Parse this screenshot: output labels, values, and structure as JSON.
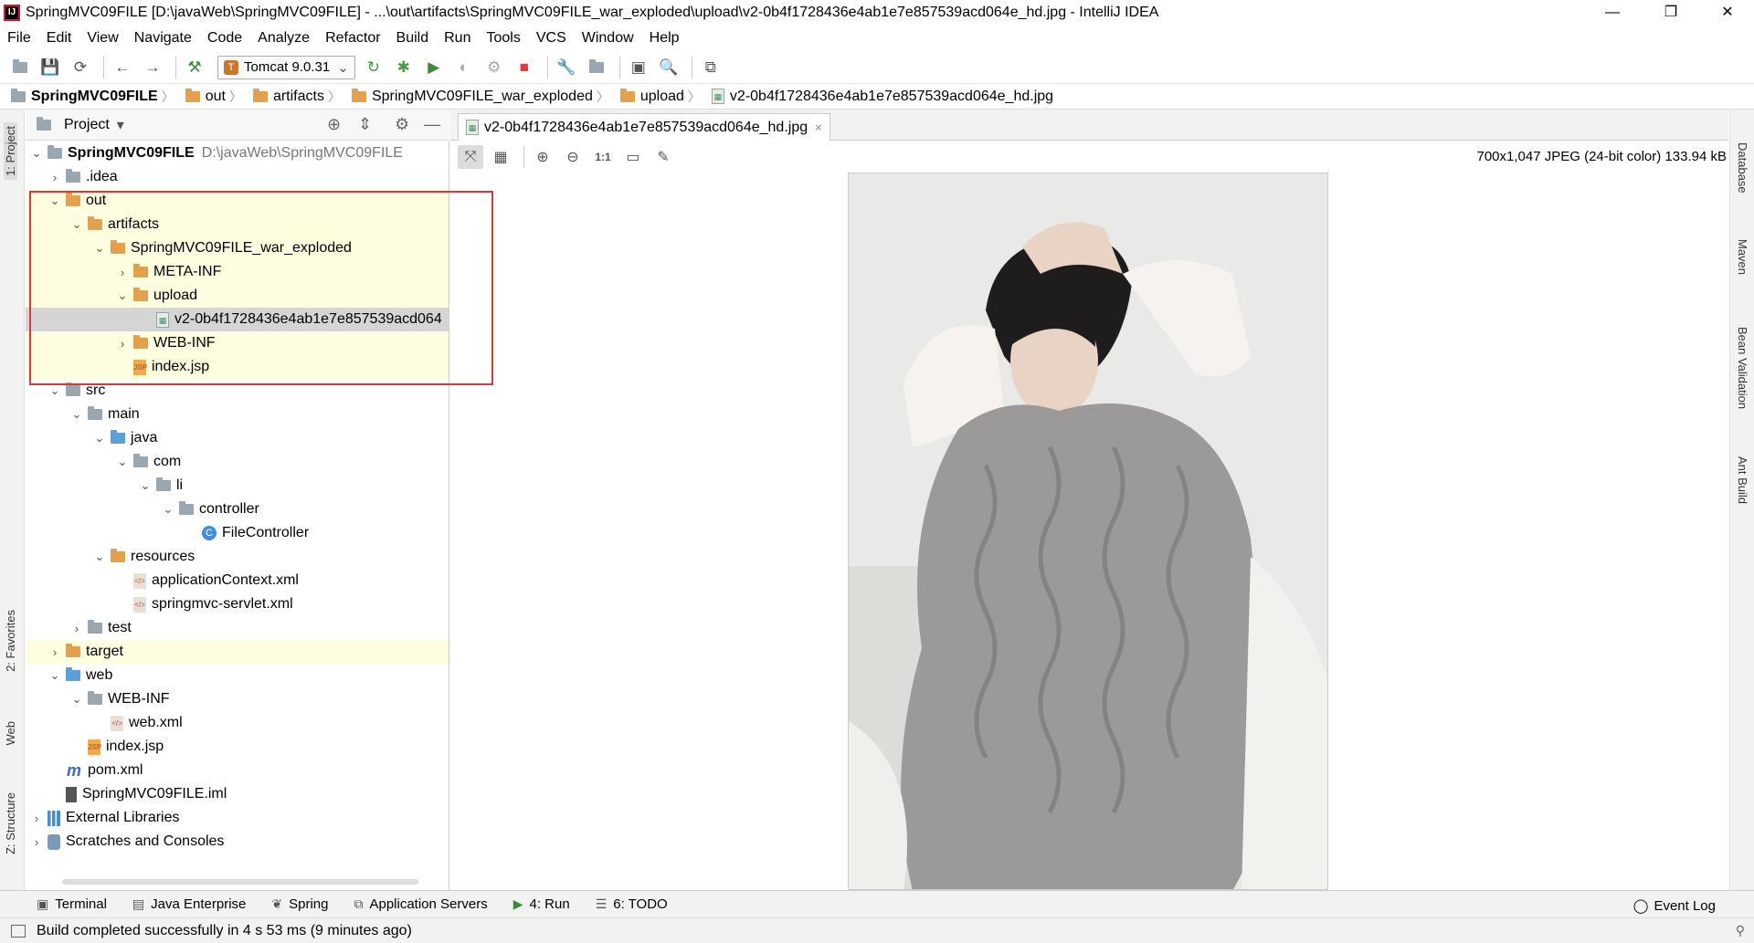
{
  "window": {
    "title": "SpringMVC09FILE [D:\\javaWeb\\SpringMVC09FILE] - ...\\out\\artifacts\\SpringMVC09FILE_war_exploded\\upload\\v2-0b4f1728436e4ab1e7e857539acd064e_hd.jpg - IntelliJ IDEA",
    "app_icon": "IJ",
    "minimize": "—",
    "restore": "❐",
    "close": "✕"
  },
  "menu": [
    "File",
    "Edit",
    "View",
    "Navigate",
    "Code",
    "Analyze",
    "Refactor",
    "Build",
    "Run",
    "Tools",
    "VCS",
    "Window",
    "Help"
  ],
  "toolbar": {
    "run_config": "Tomcat 9.0.31",
    "run_config_arrow": "⌄"
  },
  "breadcrumb": [
    "SpringMVC09FILE",
    "out",
    "artifacts",
    "SpringMVC09FILE_war_exploded",
    "upload",
    "v2-0b4f1728436e4ab1e7e857539acd064e_hd.jpg"
  ],
  "project_panel": {
    "title": "Project",
    "dropdown": "▾"
  },
  "tree": [
    {
      "label": "SpringMVC09FILE",
      "path": "D:\\javaWeb\\SpringMVC09FILE",
      "arrow": "⌄",
      "icon": "folder-gray"
    },
    {
      "label": ".idea",
      "arrow": "›",
      "icon": "folder-gray"
    },
    {
      "label": "out",
      "arrow": "⌄",
      "icon": "folder-orange"
    },
    {
      "label": "artifacts",
      "arrow": "⌄",
      "icon": "folder-orange"
    },
    {
      "label": "SpringMVC09FILE_war_exploded",
      "arrow": "⌄",
      "icon": "folder-orange"
    },
    {
      "label": "META-INF",
      "arrow": "›",
      "icon": "folder-orange"
    },
    {
      "label": "upload",
      "arrow": "⌄",
      "icon": "folder-orange"
    },
    {
      "label": "v2-0b4f1728436e4ab1e7e857539acd064",
      "arrow": "",
      "icon": "image-file"
    },
    {
      "label": "WEB-INF",
      "arrow": "›",
      "icon": "folder-orange"
    },
    {
      "label": "index.jsp",
      "arrow": "",
      "icon": "jsp-file"
    },
    {
      "label": "src",
      "arrow": "⌄",
      "icon": "folder-gray"
    },
    {
      "label": "main",
      "arrow": "⌄",
      "icon": "folder-gray"
    },
    {
      "label": "java",
      "arrow": "⌄",
      "icon": "folder-blue"
    },
    {
      "label": "com",
      "arrow": "⌄",
      "icon": "folder-gray"
    },
    {
      "label": "li",
      "arrow": "⌄",
      "icon": "folder-gray"
    },
    {
      "label": "controller",
      "arrow": "⌄",
      "icon": "folder-gray"
    },
    {
      "label": "FileController",
      "arrow": "",
      "icon": "class-file"
    },
    {
      "label": "resources",
      "arrow": "⌄",
      "icon": "folder-orange"
    },
    {
      "label": "applicationContext.xml",
      "arrow": "",
      "icon": "xml-file"
    },
    {
      "label": "springmvc-servlet.xml",
      "arrow": "",
      "icon": "xml-file"
    },
    {
      "label": "test",
      "arrow": "›",
      "icon": "folder-gray"
    },
    {
      "label": "target",
      "arrow": "›",
      "icon": "folder-orange"
    },
    {
      "label": "web",
      "arrow": "⌄",
      "icon": "folder-blue"
    },
    {
      "label": "WEB-INF",
      "arrow": "⌄",
      "icon": "folder-gray"
    },
    {
      "label": "web.xml",
      "arrow": "",
      "icon": "xml-file"
    },
    {
      "label": "index.jsp",
      "arrow": "",
      "icon": "jsp-file"
    },
    {
      "label": "pom.xml",
      "arrow": "",
      "icon": "maven-file"
    },
    {
      "label": "SpringMVC09FILE.iml",
      "arrow": "",
      "icon": "iml-file"
    },
    {
      "label": "External Libraries",
      "arrow": "›",
      "icon": "library"
    },
    {
      "label": "Scratches and Consoles",
      "arrow": "›",
      "icon": "scratches"
    }
  ],
  "left_strip": [
    "1: Project",
    "2: Favorites",
    "Web",
    "Z: Structure"
  ],
  "right_strip": [
    "Database",
    "Maven",
    "Bean Validation",
    "Ant Build"
  ],
  "editor": {
    "tab_label": "v2-0b4f1728436e4ab1e7e857539acd064e_hd.jpg",
    "tab_close": "×",
    "image_info": "700x1,047 JPEG (24-bit color) 133.94 kB",
    "zoom_actual": "1:1"
  },
  "bottom_tabs": [
    "Terminal",
    "Java Enterprise",
    "Spring",
    "Application Servers",
    "4: Run",
    "6: TODO"
  ],
  "event_log": "Event Log",
  "status": "Build completed successfully in 4 s 53 ms (9 minutes ago)"
}
